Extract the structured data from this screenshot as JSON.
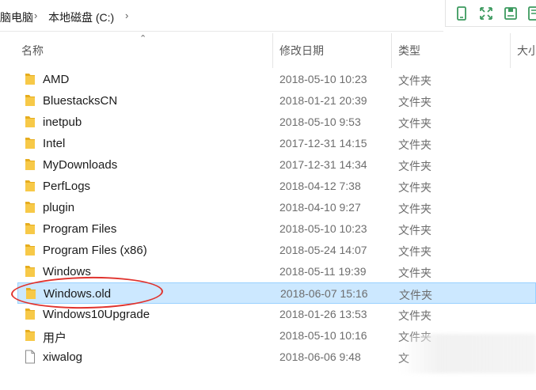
{
  "breadcrumb": {
    "parent": "脑电脑",
    "current": "本地磁盘 (C:)"
  },
  "toolbar": {
    "icons": [
      "phone-icon",
      "expand-icon",
      "save-icon",
      "notebook-icon"
    ],
    "accent": "#3c9a5f"
  },
  "columns": {
    "name": "名称",
    "date": "修改日期",
    "type": "类型",
    "size": "大小"
  },
  "rows": [
    {
      "name": "AMD",
      "date": "2018-05-10 10:23",
      "type": "文件夹",
      "kind": "folder"
    },
    {
      "name": "BluestacksCN",
      "date": "2018-01-21 20:39",
      "type": "文件夹",
      "kind": "folder"
    },
    {
      "name": "inetpub",
      "date": "2018-05-10 9:53",
      "type": "文件夹",
      "kind": "folder"
    },
    {
      "name": "Intel",
      "date": "2017-12-31 14:15",
      "type": "文件夹",
      "kind": "folder"
    },
    {
      "name": "MyDownloads",
      "date": "2017-12-31 14:34",
      "type": "文件夹",
      "kind": "folder"
    },
    {
      "name": "PerfLogs",
      "date": "2018-04-12 7:38",
      "type": "文件夹",
      "kind": "folder"
    },
    {
      "name": "plugin",
      "date": "2018-04-10 9:27",
      "type": "文件夹",
      "kind": "folder"
    },
    {
      "name": "Program Files",
      "date": "2018-05-10 10:23",
      "type": "文件夹",
      "kind": "folder"
    },
    {
      "name": "Program Files (x86)",
      "date": "2018-05-24 14:07",
      "type": "文件夹",
      "kind": "folder"
    },
    {
      "name": "Windows",
      "date": "2018-05-11 19:39",
      "type": "文件夹",
      "kind": "folder"
    },
    {
      "name": "Windows.old",
      "date": "2018-06-07 15:16",
      "type": "文件夹",
      "kind": "folder",
      "selected": true
    },
    {
      "name": "Windows10Upgrade",
      "date": "2018-01-26 13:53",
      "type": "文件夹",
      "kind": "folder"
    },
    {
      "name": "用户",
      "date": "2018-05-10 10:16",
      "type": "文件夹",
      "kind": "folder"
    },
    {
      "name": "xiwalog",
      "date": "2018-06-06 9:48",
      "type": "文",
      "kind": "file"
    }
  ],
  "colors": {
    "folder": "#f7c948",
    "folder_dark": "#e6ad1f",
    "selected_bg": "#cce8ff",
    "highlight_ring": "#e0332e"
  }
}
